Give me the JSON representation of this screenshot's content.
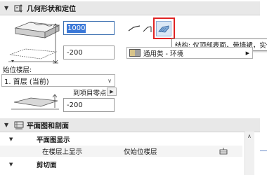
{
  "section1": {
    "title": "几何形状和定位"
  },
  "fields": {
    "top_value": "1000",
    "thickness_value": "-200",
    "offset_value": "-200"
  },
  "story": {
    "label": "始位楼层:",
    "selected": "1. 首层 (当前)"
  },
  "project_zero": {
    "label": "到项目零点"
  },
  "geometry_tooltip": "结构: 仅顶部表面，带墙裙，实体",
  "surface": {
    "selected": "通用类 - 环境"
  },
  "section2": {
    "title": "平面图和剖面"
  },
  "tree": {
    "plan_display": "平面图显示",
    "show_on_stories_label": "在楼层上显示",
    "show_on_stories_value": "仅始位楼层",
    "cut_surfaces": "剪切面"
  }
}
